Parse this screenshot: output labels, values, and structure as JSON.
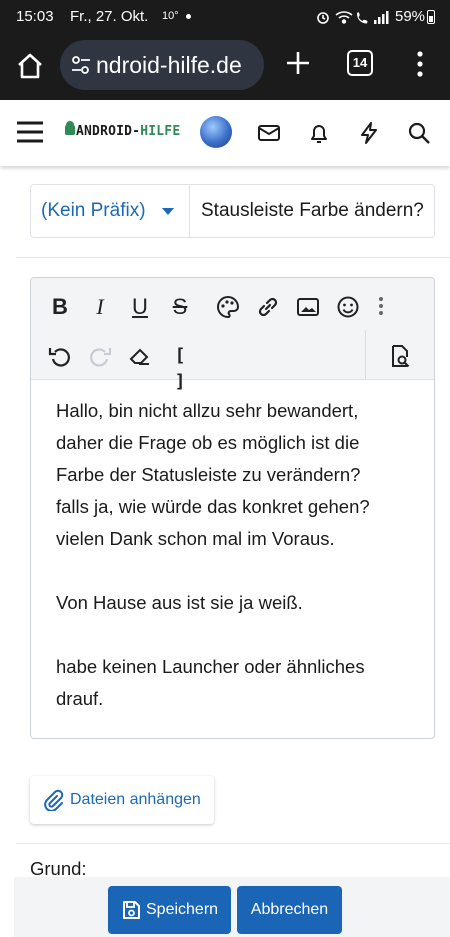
{
  "status_bar": {
    "time": "15:03",
    "date": "Fr., 27. Okt.",
    "temperature": "10°",
    "battery": "59%"
  },
  "browser": {
    "url": "ndroid-hilfe.de",
    "tab_count": "14"
  },
  "site": {
    "logo_prefix": "ANDROID-",
    "logo_accent": "HILFE",
    "brand_color": "#2e8b57"
  },
  "form": {
    "prefix_selected": "(Kein Präfix)",
    "title_value": "Stausleiste Farbe ändern?",
    "content_lines": [
      "Hallo, bin nicht allzu sehr bewandert,",
      "daher die Frage ob es möglich ist die",
      "Farbe der Statusleiste zu verändern?",
      "falls ja, wie würde das konkret gehen?",
      "vielen Dank schon mal im Voraus.",
      "",
      "Von Hause aus ist sie ja weiß.",
      "",
      "habe keinen Launcher oder ähnliches",
      "drauf."
    ],
    "attach_label": "Dateien anhängen",
    "reason_label": "Grund:",
    "save_label": "Speichern",
    "cancel_label": "Abbrechen"
  },
  "toolbar": {
    "bold": "B",
    "italic": "I",
    "underline": "U",
    "strike": "S",
    "bbcode": "[ ]"
  },
  "colors": {
    "primary_button": "#1a65b5",
    "link": "#1b69b6",
    "dark_bar": "#1b1b1b"
  }
}
